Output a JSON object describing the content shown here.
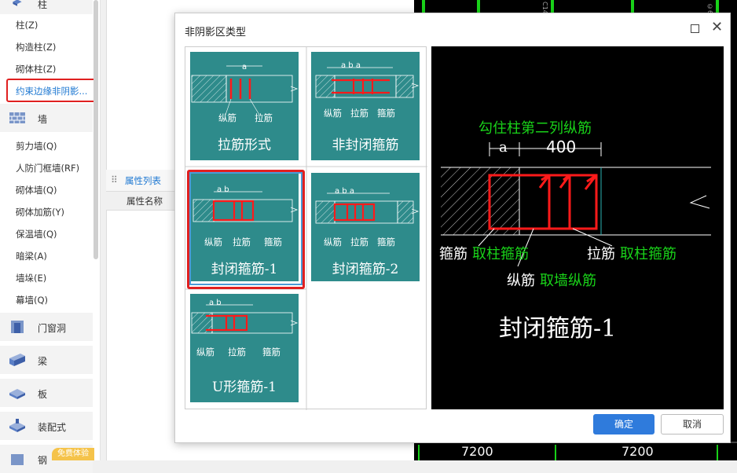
{
  "sidebar": {
    "top_label": "柱",
    "items_col": [
      "柱(Z)",
      "构造柱(Z)",
      "砌体柱(Z)"
    ],
    "selected": "约束边缘非阴影...",
    "wall_cat": "墙",
    "items_wall": [
      "剪力墙(Q)",
      "人防门框墙(RF)",
      "砌体墙(Q)",
      "砌体加筋(Y)",
      "保温墙(Q)",
      "暗梁(A)",
      "墙垛(E)",
      "幕墙(Q)"
    ],
    "categories": [
      "门窗洞",
      "梁",
      "板",
      "装配式"
    ],
    "bottom_cat": "钢",
    "badge": "免费体验"
  },
  "props": {
    "tab": "属性列表",
    "col_name": "属性名称"
  },
  "dialog": {
    "title": "非阴影区类型",
    "ok": "确定",
    "cancel": "取消",
    "options": [
      {
        "caption": "拉筋形式",
        "labels": [
          "纵筋",
          "拉筋"
        ],
        "dim": "a"
      },
      {
        "caption": "非封闭箍筋",
        "labels": [
          "纵筋",
          "拉筋",
          "箍筋"
        ],
        "dim": "a b a"
      },
      {
        "caption": "封闭箍筋-1",
        "labels": [
          "纵筋",
          "拉筋",
          "箍筋"
        ],
        "dim": "a b"
      },
      {
        "caption": "封闭箍筋-2",
        "labels": [
          "纵筋",
          "拉筋",
          "箍筋"
        ],
        "dim": "a b a"
      },
      {
        "caption": "U形箍筋-1",
        "labels": [
          "纵筋",
          "拉筋",
          "箍筋"
        ],
        "dim": "a b"
      }
    ],
    "selected_index": 2,
    "preview": {
      "top_note": "勾住柱第二列纵筋",
      "dim_a": "a",
      "dim_b": "400",
      "left_label_white": "箍筋",
      "left_label_green": "取柱箍筋",
      "right_label_white": "拉筋",
      "right_label_green": "取柱箍筋",
      "bottom_label_white": "纵筋",
      "bottom_label_green": "取墙纵筋",
      "title": "封闭箍筋-1"
    }
  },
  "cad": {
    "bottom_numbers": [
      "7200",
      "7200"
    ],
    "side_text": [
      "C14",
      "©6"
    ]
  },
  "colors": {
    "teal": "#2e8b8b",
    "select_red": "#e02020",
    "rebar_red": "#ff1a1a",
    "cad_green": "#19d219",
    "primary_blue": "#2f7bdc"
  }
}
